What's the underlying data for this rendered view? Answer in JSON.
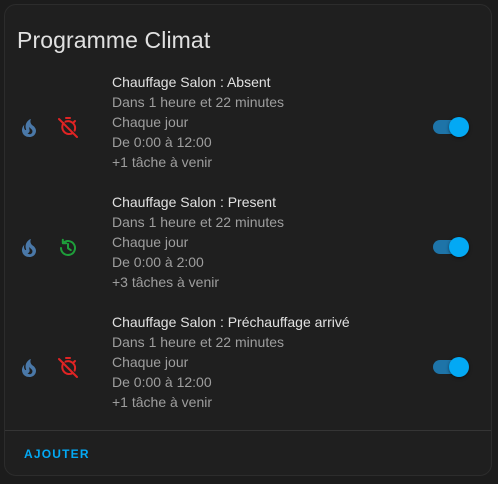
{
  "card": {
    "title": "Programme Climat",
    "add_label": "AJOUTER"
  },
  "colors": {
    "background": "#1f1f1f",
    "accent": "#03a9f4",
    "heat_icon": "#4a78a8",
    "disabled_icon": "#e02424",
    "enabled_icon": "#1e9e3a"
  },
  "entries": [
    {
      "name": "Chauffage Salon : Absent",
      "next": "Dans 1 heure et 22 minutes",
      "days": "Chaque jour",
      "time": "De 0:00 à 12:00",
      "more": "+1 tâche à venir",
      "status_icon": "timer-off-icon",
      "enabled": true
    },
    {
      "name": "Chauffage Salon : Present",
      "next": "Dans 1 heure et 22 minutes",
      "days": "Chaque jour",
      "time": "De 0:00 à 2:00",
      "more": "+3 tâches à venir",
      "status_icon": "history-icon",
      "enabled": true
    },
    {
      "name": "Chauffage Salon : Préchauffage arrivé",
      "next": "Dans 1 heure et 22 minutes",
      "days": "Chaque jour",
      "time": "De 0:00 à 12:00",
      "more": "+1 tâche à venir",
      "status_icon": "timer-off-icon",
      "enabled": true
    }
  ]
}
